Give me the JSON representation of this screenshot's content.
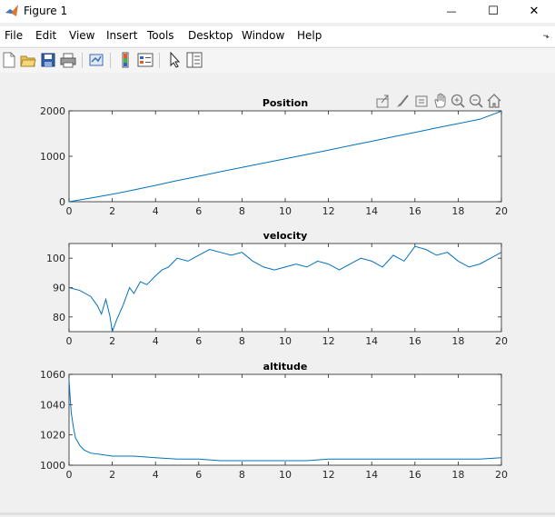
{
  "window": {
    "title": "Figure 1",
    "minimize_glyph": "—",
    "maximize_glyph": "☐",
    "close_glyph": "✕"
  },
  "menu": {
    "items": [
      "File",
      "Edit",
      "View",
      "Insert",
      "Tools",
      "Desktop",
      "Window",
      "Help"
    ],
    "overflow_glyph": "⬎"
  },
  "toolbar": {
    "icons": [
      "new-figure-icon",
      "open-file-icon",
      "save-icon",
      "print-icon",
      "link-plot-icon",
      "insert-colorbar-icon",
      "insert-legend-icon",
      "select-arrow-icon",
      "property-inspector-icon"
    ]
  },
  "axes_toolbar": {
    "icons": [
      "export-icon",
      "brush-icon",
      "data-tips-icon",
      "pan-icon",
      "zoom-in-icon",
      "zoom-out-icon",
      "home-icon"
    ]
  },
  "colors": {
    "line": "#0072bd",
    "axes_bg": "#ffffff",
    "figure_bg": "#f0f0f0"
  },
  "chart_data": [
    {
      "type": "line",
      "title": "Position",
      "xlim": [
        0,
        20
      ],
      "ylim": [
        0,
        2000
      ],
      "xticks": [
        0,
        2,
        4,
        6,
        8,
        10,
        12,
        14,
        16,
        18,
        20
      ],
      "yticks": [
        0,
        1000,
        2000
      ],
      "x": [
        0,
        1,
        2,
        3,
        4,
        5,
        6,
        7,
        8,
        9,
        10,
        11,
        12,
        13,
        14,
        15,
        16,
        17,
        18,
        19,
        20
      ],
      "y": [
        0,
        80,
        165,
        260,
        360,
        465,
        560,
        660,
        755,
        850,
        945,
        1040,
        1135,
        1235,
        1330,
        1430,
        1525,
        1625,
        1720,
        1815,
        1995
      ]
    },
    {
      "type": "line",
      "title": "velocity",
      "xlim": [
        0,
        20
      ],
      "ylim": [
        75,
        105
      ],
      "xticks": [
        0,
        2,
        4,
        6,
        8,
        10,
        12,
        14,
        16,
        18,
        20
      ],
      "yticks": [
        80,
        90,
        100
      ],
      "x": [
        0,
        0.5,
        1,
        1.3,
        1.5,
        1.7,
        1.9,
        2.0,
        2.2,
        2.5,
        2.8,
        3.0,
        3.3,
        3.6,
        4.0,
        4.3,
        4.6,
        5.0,
        5.5,
        6.0,
        6.5,
        7.0,
        7.5,
        8.0,
        8.5,
        9.0,
        9.5,
        10.0,
        10.5,
        11.0,
        11.5,
        12.0,
        12.5,
        13.0,
        13.5,
        14.0,
        14.5,
        15.0,
        15.5,
        16.0,
        16.5,
        17.0,
        17.5,
        18.0,
        18.5,
        19.0,
        19.5,
        20.0
      ],
      "y": [
        90,
        89,
        87,
        84,
        81,
        86,
        80,
        75,
        79,
        84,
        90,
        88,
        92,
        91,
        94,
        96,
        97,
        100,
        99,
        101,
        103,
        102,
        101,
        102,
        99,
        97,
        96,
        97,
        98,
        97,
        99,
        98,
        96,
        98,
        100,
        99,
        97,
        101,
        99,
        104,
        103,
        101,
        102,
        99,
        97,
        98,
        100,
        102
      ]
    },
    {
      "type": "line",
      "title": "altitude",
      "xlim": [
        0,
        20
      ],
      "ylim": [
        1000,
        1060
      ],
      "xticks": [
        0,
        2,
        4,
        6,
        8,
        10,
        12,
        14,
        16,
        18,
        20
      ],
      "yticks": [
        1000,
        1020,
        1040,
        1060
      ],
      "x": [
        0,
        0.05,
        0.1,
        0.2,
        0.3,
        0.5,
        0.7,
        1.0,
        1.5,
        2.0,
        3.0,
        4.0,
        5.0,
        6.0,
        7.0,
        8.0,
        9.0,
        10.0,
        11.0,
        12.0,
        13.0,
        14.0,
        15.0,
        16.0,
        17.0,
        18.0,
        19.0,
        20.0
      ],
      "y": [
        1056,
        1045,
        1035,
        1025,
        1018,
        1013,
        1010,
        1008,
        1007,
        1006,
        1006,
        1005,
        1004,
        1004,
        1003,
        1003,
        1003,
        1003,
        1003,
        1004,
        1004,
        1004,
        1004,
        1004,
        1004,
        1004,
        1004,
        1005
      ]
    }
  ]
}
